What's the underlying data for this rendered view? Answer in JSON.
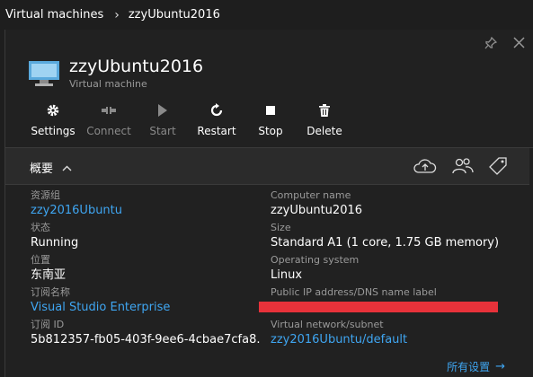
{
  "breadcrumb": {
    "parent": "Virtual machines",
    "separator": "›",
    "current": "zzyUbuntu2016"
  },
  "blade": {
    "title": "zzyUbuntu2016",
    "subtitle": "Virtual machine",
    "pin_icon": "pin-icon",
    "close_icon": "close-icon"
  },
  "toolbar": [
    {
      "label": "Settings",
      "icon": "gear-icon",
      "enabled": true
    },
    {
      "label": "Connect",
      "icon": "connect-icon",
      "enabled": false
    },
    {
      "label": "Start",
      "icon": "play-icon",
      "enabled": false
    },
    {
      "label": "Restart",
      "icon": "restart-icon",
      "enabled": true
    },
    {
      "label": "Stop",
      "icon": "stop-icon",
      "enabled": true
    },
    {
      "label": "Delete",
      "icon": "trash-icon",
      "enabled": true
    }
  ],
  "essentials": {
    "title": "概要",
    "icons": [
      "cloud-upload-icon",
      "users-icon",
      "tag-icon"
    ]
  },
  "left_props": [
    {
      "label": "资源组",
      "value": "zzy2016Ubuntu",
      "link": true
    },
    {
      "label": "状态",
      "value": "Running",
      "link": false
    },
    {
      "label": "位置",
      "value": "东南亚",
      "link": false
    },
    {
      "label": "订阅名称",
      "value": "Visual Studio Enterprise",
      "link": true
    },
    {
      "label": "订阅 ID",
      "value": "5b812357-fb05-403f-9ee6-4cbae7cfa8...",
      "link": false
    }
  ],
  "right_props": [
    {
      "label": "Computer name",
      "value": "zzyUbuntu2016",
      "link": false
    },
    {
      "label": "Size",
      "value": "Standard A1 (1 core, 1.75 GB memory)",
      "link": false
    },
    {
      "label": "Operating system",
      "value": "Linux",
      "link": false
    },
    {
      "label": "Public IP address/DNS name label",
      "value": "",
      "link": false,
      "redacted": true
    },
    {
      "label": "Virtual network/subnet",
      "value": "zzy2016Ubuntu/default",
      "link": true
    }
  ],
  "all_settings": {
    "label": "所有设置",
    "arrow": "→"
  },
  "colors": {
    "background": "#1e1e1e",
    "link": "#3fa6f2",
    "redaction": "#e8323a",
    "muted": "#9a9a9a"
  }
}
